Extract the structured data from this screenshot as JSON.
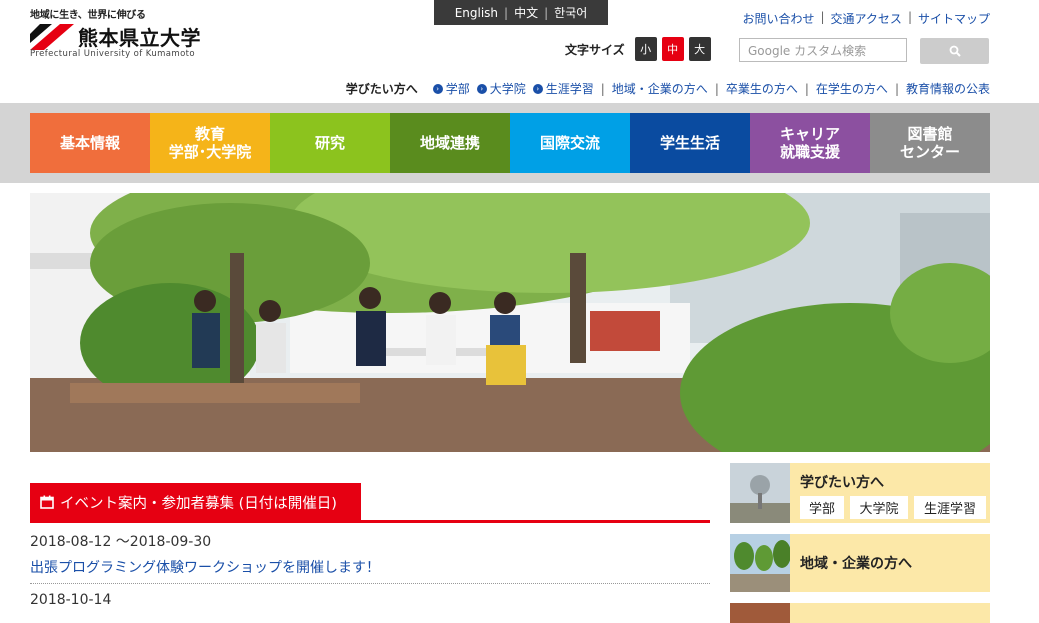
{
  "header": {
    "logo_tagline": "地域に生き、世界に伸びる",
    "logo_name": "熊本県立大学",
    "logo_sub": "Prefectural University of Kumamoto",
    "languages": [
      "English",
      "中文",
      "한국어"
    ],
    "top_links": [
      "お問い合わせ",
      "交通アクセス",
      "サイトマップ"
    ],
    "fontsize_label": "文字サイズ",
    "fontsize_options": [
      "小",
      "中",
      "大"
    ],
    "fontsize_selected": "中",
    "search_placeholder": "Google カスタム検索",
    "search_icon": "search-icon"
  },
  "audience": {
    "lead": "学びたい方へ",
    "items": [
      "学部",
      "大学院",
      "生涯学習"
    ],
    "links": [
      "地域・企業の方へ",
      "卒業生の方へ",
      "在学生の方へ",
      "教育情報の公表"
    ]
  },
  "nav": {
    "items": [
      {
        "label": "基本情報",
        "color": "#f06e3c"
      },
      {
        "label": "教育\n学部･大学院",
        "color": "#f5b419"
      },
      {
        "label": "研究",
        "color": "#8cc31e"
      },
      {
        "label": "地域連携",
        "color": "#5a8c1e"
      },
      {
        "label": "国際交流",
        "color": "#00a0e6"
      },
      {
        "label": "学生生活",
        "color": "#0a4ba0"
      },
      {
        "label": "キャリア\n就職支援",
        "color": "#8c50a0"
      },
      {
        "label": "図書館\nセンター",
        "color": "#8c8c8c"
      }
    ]
  },
  "events": {
    "heading": "イベント案内・参加者募集 (日付は開催日)",
    "heading_icon": "calendar-icon",
    "items": [
      {
        "date": "2018-08-12 ～2018-09-30",
        "title": "出張プログラミング体験ワークショップを開催します！"
      },
      {
        "date": "2018-10-14",
        "title": ""
      }
    ]
  },
  "side": {
    "learn": {
      "title": "学びたい方へ",
      "buttons": [
        "学部",
        "大学院",
        "生涯学習"
      ]
    },
    "community": {
      "title": "地域・企業の方へ"
    }
  },
  "colors": {
    "accent": "#e60012",
    "link": "#1a4fa8",
    "panel": "#fce8a8"
  }
}
